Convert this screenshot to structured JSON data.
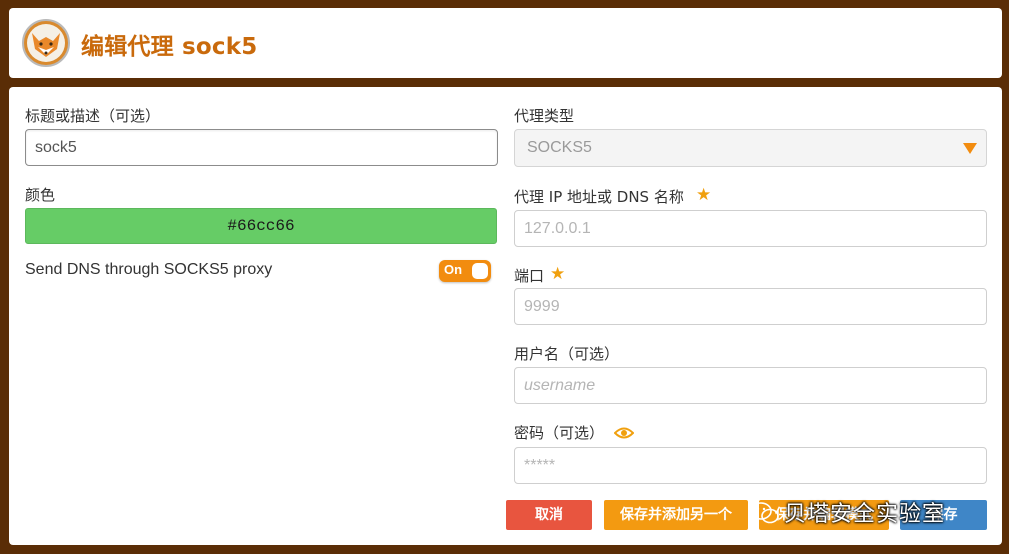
{
  "header": {
    "title": "编辑代理 sock5"
  },
  "form": {
    "title_label": "标题或描述（可选）",
    "title_value": "sock5",
    "color_label": "颜色",
    "color_value": "#66cc66",
    "dns_label": "Send DNS through SOCKS5 proxy",
    "dns_toggle": "On",
    "proxy_type_label": "代理类型",
    "proxy_type_value": "SOCKS5",
    "host_label": "代理 IP 地址或 DNS 名称",
    "host_placeholder": "127.0.0.1",
    "port_label": "端口",
    "port_placeholder": "9999",
    "username_label": "用户名（可选）",
    "username_placeholder": "username",
    "password_label": "密码（可选）",
    "password_placeholder": "*****"
  },
  "buttons": {
    "cancel": "取消",
    "save_add": "保存并添加另一个",
    "save": "保存并编辑模式",
    "blue": "保存"
  },
  "watermark": {
    "text": "贝塔安全实验室"
  },
  "colors": {
    "accent": "#f28c0f",
    "title": "#c96a0c",
    "cancel": "#e8553f",
    "background": "#5a2d06",
    "swatch": "#66cc66"
  },
  "icons": {
    "logo": "fox-logo-icon",
    "star": "star-icon",
    "eye": "eye-icon",
    "arrow": "dropdown-arrow-icon"
  }
}
